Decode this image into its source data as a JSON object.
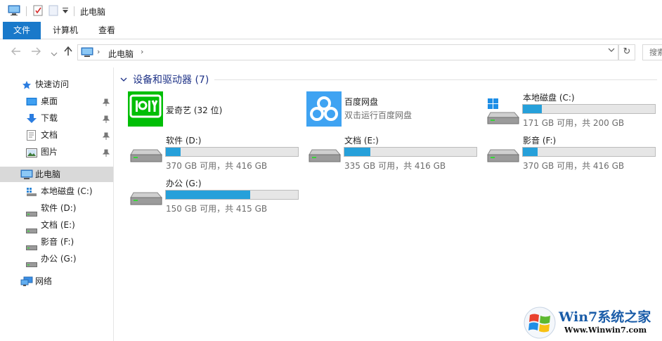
{
  "window": {
    "title": "此电脑"
  },
  "ribbon": {
    "tabs": [
      {
        "label": "文件"
      },
      {
        "label": "计算机"
      },
      {
        "label": "查看"
      }
    ]
  },
  "address": {
    "path": "此电脑",
    "search_placeholder": "搜索"
  },
  "sidebar": {
    "items": [
      {
        "label": "快速访问",
        "icon": "star-icon"
      },
      {
        "label": "桌面",
        "icon": "desktop-folder-icon",
        "pinned": true
      },
      {
        "label": "下载",
        "icon": "download-arrow-icon",
        "pinned": true
      },
      {
        "label": "文档",
        "icon": "document-icon",
        "pinned": true
      },
      {
        "label": "图片",
        "icon": "picture-icon",
        "pinned": true
      },
      {
        "label": "此电脑",
        "icon": "computer-icon",
        "selected": true
      },
      {
        "label": "本地磁盘 (C:)",
        "icon": "system-drive-icon"
      },
      {
        "label": "软件 (D:)",
        "icon": "drive-icon"
      },
      {
        "label": "文档 (E:)",
        "icon": "drive-icon"
      },
      {
        "label": "影音 (F:)",
        "icon": "drive-icon"
      },
      {
        "label": "办公 (G:)",
        "icon": "drive-icon"
      },
      {
        "label": "网络",
        "icon": "network-icon"
      }
    ]
  },
  "content": {
    "group_title": "设备和驱动器 (7)",
    "apps": [
      {
        "name": "爱奇艺 (32 位)",
        "icon": "iqiyi-icon"
      },
      {
        "name": "百度网盘",
        "subtitle": "双击运行百度网盘",
        "icon": "baidu-netdisk-icon"
      }
    ],
    "drives": [
      {
        "name": "本地磁盘 (C:)",
        "usage": "171 GB 可用，共 200 GB",
        "used_fraction": 0.145
      },
      {
        "name": "软件 (D:)",
        "usage": "370 GB 可用，共 416 GB",
        "used_fraction": 0.11
      },
      {
        "name": "文档 (E:)",
        "usage": "335 GB 可用，共 416 GB",
        "used_fraction": 0.195
      },
      {
        "name": "影音 (F:)",
        "usage": "370 GB 可用，共 416 GB",
        "used_fraction": 0.11
      },
      {
        "name": "办公 (G:)",
        "usage": "150 GB 可用，共 415 GB",
        "used_fraction": 0.64
      }
    ]
  },
  "watermark": {
    "title": "Win7系统之家",
    "url": "Www.Winwin7.com"
  },
  "colors": {
    "accent": "#1979ca",
    "bar_fill": "#26a0da",
    "group_title": "#1e3287"
  }
}
